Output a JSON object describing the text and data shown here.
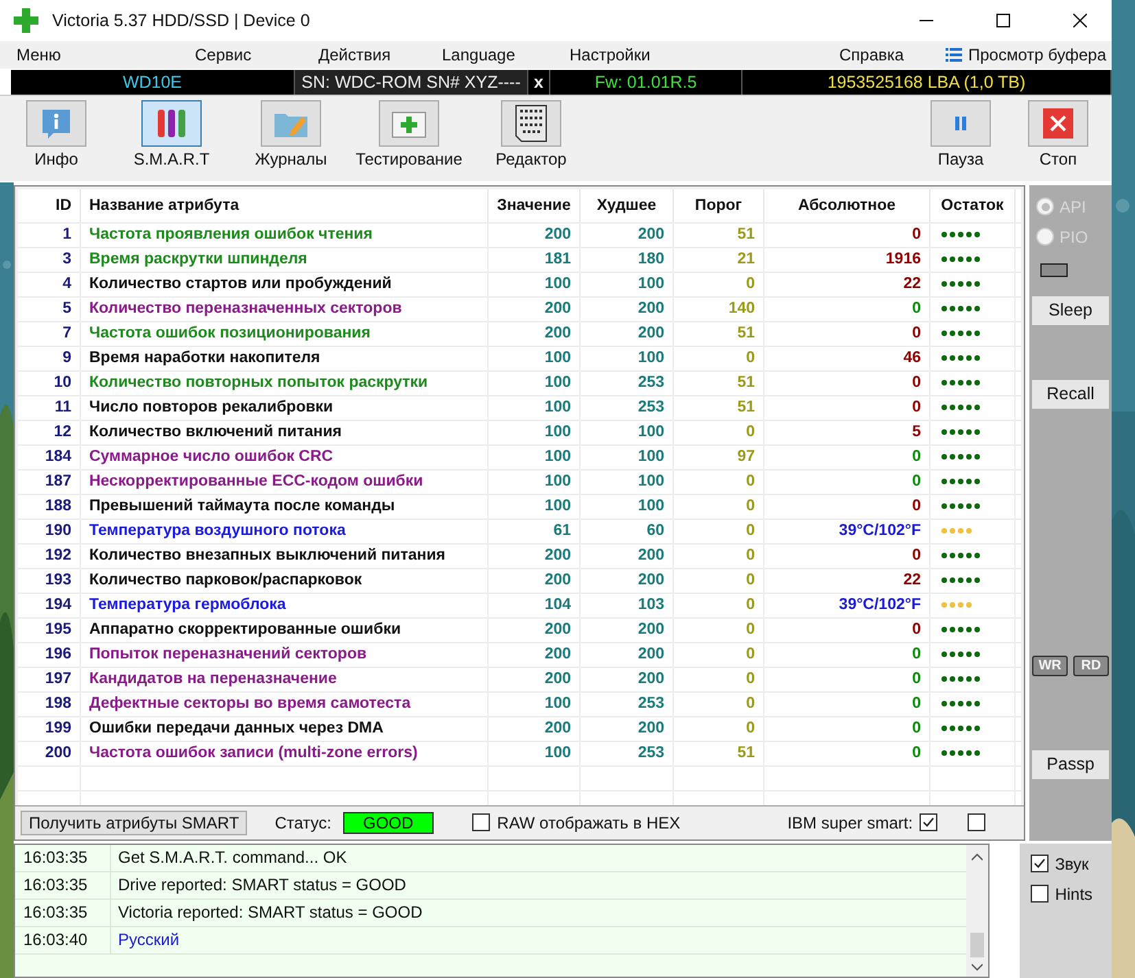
{
  "window": {
    "title": "Victoria 5.37 HDD/SSD | Device 0"
  },
  "menu": [
    {
      "label": "Меню"
    },
    {
      "label": "Сервис"
    },
    {
      "label": "Действия"
    },
    {
      "label": "Language"
    },
    {
      "label": "Настройки"
    },
    {
      "label": "Справка"
    }
  ],
  "buffer_view": "Просмотр буфера",
  "drive_bar": {
    "model": "WD10E",
    "serial": "SN: WDC-ROM SN# XYZ----",
    "close": "x",
    "firmware": "Fw: 01.01R.5",
    "capacity": "1953525168 LBA (1,0 TB)"
  },
  "toolbar": [
    {
      "label": "Инфо",
      "kind": "info",
      "selected": false
    },
    {
      "label": "S.M.A.R.T",
      "kind": "smart",
      "selected": true
    },
    {
      "label": "Журналы",
      "kind": "logs",
      "selected": false
    },
    {
      "label": "Тестирование",
      "kind": "test",
      "selected": false
    },
    {
      "label": "Редактор",
      "kind": "editor",
      "selected": false
    }
  ],
  "toolbar_right": [
    {
      "label": "Пауза",
      "kind": "pause"
    },
    {
      "label": "Стоп",
      "kind": "stop"
    }
  ],
  "smart_table": {
    "columns": [
      "ID",
      "Название атрибута",
      "Значение",
      "Худшее",
      "Порог",
      "Абсолютное",
      "Остаток"
    ],
    "rows": [
      {
        "id": "1",
        "name": "Частота проявления ошибок чтения",
        "color": "#1e8a1e",
        "value": "200",
        "worst": "200",
        "threshold": "51",
        "raw": "0",
        "kind": "alert",
        "stars": 5
      },
      {
        "id": "3",
        "name": "Время раскрутки шпинделя",
        "color": "#1e8a1e",
        "value": "181",
        "worst": "180",
        "threshold": "21",
        "raw": "1916",
        "kind": "alert",
        "stars": 5
      },
      {
        "id": "4",
        "name": "Количество стартов или пробуждений",
        "color": "#111111",
        "value": "100",
        "worst": "100",
        "threshold": "0",
        "raw": "22",
        "kind": "alert",
        "stars": 5
      },
      {
        "id": "5",
        "name": "Количество переназначенных секторов",
        "color": "#8a1a8a",
        "value": "200",
        "worst": "200",
        "threshold": "140",
        "raw": "0",
        "kind": "ok",
        "stars": 5
      },
      {
        "id": "7",
        "name": "Частота ошибок позиционирования",
        "color": "#1e8a1e",
        "value": "200",
        "worst": "200",
        "threshold": "51",
        "raw": "0",
        "kind": "alert",
        "stars": 5
      },
      {
        "id": "9",
        "name": "Время наработки накопителя",
        "color": "#111111",
        "value": "100",
        "worst": "100",
        "threshold": "0",
        "raw": "46",
        "kind": "alert",
        "stars": 5
      },
      {
        "id": "10",
        "name": "Количество повторных попыток раскрутки",
        "color": "#1e8a1e",
        "value": "100",
        "worst": "253",
        "threshold": "51",
        "raw": "0",
        "kind": "alert",
        "stars": 5
      },
      {
        "id": "11",
        "name": "Число повторов рекалибровки",
        "color": "#111111",
        "value": "100",
        "worst": "253",
        "threshold": "51",
        "raw": "0",
        "kind": "alert",
        "stars": 5
      },
      {
        "id": "12",
        "name": "Количество включений питания",
        "color": "#111111",
        "value": "100",
        "worst": "100",
        "threshold": "0",
        "raw": "5",
        "kind": "alert",
        "stars": 5
      },
      {
        "id": "184",
        "name": "Суммарное число ошибок CRC",
        "color": "#8a1a8a",
        "value": "100",
        "worst": "100",
        "threshold": "97",
        "raw": "0",
        "kind": "ok",
        "stars": 5
      },
      {
        "id": "187",
        "name": "Нескорректированные ECC-кодом ошибки",
        "color": "#8a1a8a",
        "value": "100",
        "worst": "100",
        "threshold": "0",
        "raw": "0",
        "kind": "ok",
        "stars": 5
      },
      {
        "id": "188",
        "name": "Превышений таймаута после команды",
        "color": "#111111",
        "value": "100",
        "worst": "100",
        "threshold": "0",
        "raw": "0",
        "kind": "alert",
        "stars": 5
      },
      {
        "id": "190",
        "name": "Температура воздушного потока",
        "color": "#1a1ae0",
        "value": "61",
        "worst": "60",
        "threshold": "0",
        "raw": "39°C/102°F",
        "kind": "temperature",
        "stars": 4
      },
      {
        "id": "192",
        "name": "Количество внезапных выключений питания",
        "color": "#111111",
        "value": "200",
        "worst": "200",
        "threshold": "0",
        "raw": "0",
        "kind": "alert",
        "stars": 5
      },
      {
        "id": "193",
        "name": "Количество парковок/распарковок",
        "color": "#111111",
        "value": "200",
        "worst": "200",
        "threshold": "0",
        "raw": "22",
        "kind": "alert",
        "stars": 5
      },
      {
        "id": "194",
        "name": "Температура гермоблока",
        "color": "#1a1ae0",
        "value": "104",
        "worst": "103",
        "threshold": "0",
        "raw": "39°C/102°F",
        "kind": "temperature",
        "stars": 4
      },
      {
        "id": "195",
        "name": "Аппаратно скорректированные ошибки",
        "color": "#111111",
        "value": "200",
        "worst": "200",
        "threshold": "0",
        "raw": "0",
        "kind": "alert",
        "stars": 5
      },
      {
        "id": "196",
        "name": "Попыток переназначений секторов",
        "color": "#8a1a8a",
        "value": "200",
        "worst": "200",
        "threshold": "0",
        "raw": "0",
        "kind": "ok",
        "stars": 5
      },
      {
        "id": "197",
        "name": "Кандидатов на переназначение",
        "color": "#8a1a8a",
        "value": "200",
        "worst": "200",
        "threshold": "0",
        "raw": "0",
        "kind": "ok",
        "stars": 5
      },
      {
        "id": "198",
        "name": "Дефектные секторы во время самотеста",
        "color": "#8a1a8a",
        "value": "100",
        "worst": "253",
        "threshold": "0",
        "raw": "0",
        "kind": "ok",
        "stars": 5
      },
      {
        "id": "199",
        "name": "Ошибки передачи данных через DMA",
        "color": "#111111",
        "value": "200",
        "worst": "200",
        "threshold": "0",
        "raw": "0",
        "kind": "ok",
        "stars": 5
      },
      {
        "id": "200",
        "name": "Частота ошибок записи (multi-zone errors)",
        "color": "#8a1a8a",
        "value": "100",
        "worst": "253",
        "threshold": "51",
        "raw": "0",
        "kind": "ok",
        "stars": 5
      }
    ]
  },
  "smart_bar": {
    "button": "Получить атрибуты SMART",
    "status_label": "Статус:",
    "status": "GOOD",
    "raw_hex": {
      "label": "RAW отображать в HEX",
      "checked": false
    },
    "ibm": {
      "label": "IBM super smart:",
      "checked": true
    },
    "extra": {
      "checked": false
    }
  },
  "side_panel": {
    "modes": [
      {
        "label": "API",
        "selected": true
      },
      {
        "label": "PIO",
        "selected": false
      }
    ],
    "buttons": [
      "Sleep",
      "Recall"
    ],
    "indicators": [
      "WR",
      "RD"
    ],
    "passp": "Passp"
  },
  "log": [
    {
      "time": "16:03:35",
      "message": "Get S.M.A.R.T. command... OK",
      "kind": "info"
    },
    {
      "time": "16:03:35",
      "message": "Drive reported: SMART status = GOOD",
      "kind": "info"
    },
    {
      "time": "16:03:35",
      "message": "Victoria reported: SMART status = GOOD",
      "kind": "info"
    },
    {
      "time": "16:03:40",
      "message": "Русский",
      "kind": "language"
    }
  ],
  "options": [
    {
      "label": "Звук",
      "checked": true
    },
    {
      "label": "Hints",
      "checked": false
    }
  ]
}
